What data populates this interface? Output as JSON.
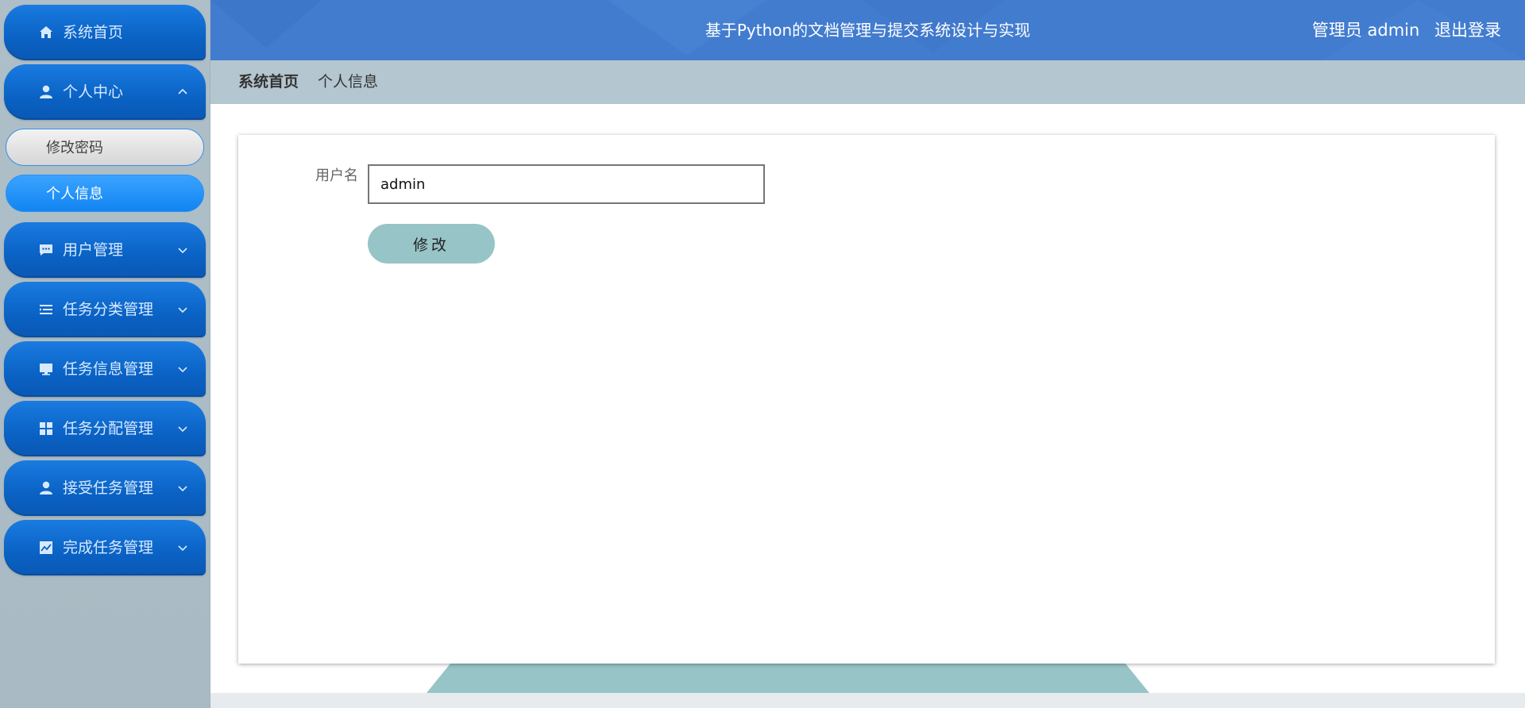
{
  "sidebar": {
    "items": [
      {
        "label": "系统首页",
        "icon": "home-icon"
      },
      {
        "label": "个人中心",
        "icon": "person-icon",
        "expanded": true,
        "children": [
          {
            "label": "修改密码",
            "active": false
          },
          {
            "label": "个人信息",
            "active": true
          }
        ]
      },
      {
        "label": "用户管理",
        "icon": "chat-icon"
      },
      {
        "label": "任务分类管理",
        "icon": "list-icon"
      },
      {
        "label": "任务信息管理",
        "icon": "monitor-icon"
      },
      {
        "label": "任务分配管理",
        "icon": "grid-icon"
      },
      {
        "label": "接受任务管理",
        "icon": "person-icon"
      },
      {
        "label": "完成任务管理",
        "icon": "chart-icon"
      }
    ]
  },
  "header": {
    "title": "基于Python的文档管理与提交系统设计与实现",
    "user_label": "管理员 admin",
    "logout_label": "退出登录"
  },
  "breadcrumb": {
    "home": "系统首页",
    "current": "个人信息"
  },
  "form": {
    "username_label": "用户名",
    "username_value": "admin",
    "submit_label": "修改"
  },
  "colors": {
    "header_bg": "#427ccf",
    "menu_blue": "#0a62c4",
    "active_sub": "#1285f2",
    "button_teal": "#97c4c7"
  }
}
